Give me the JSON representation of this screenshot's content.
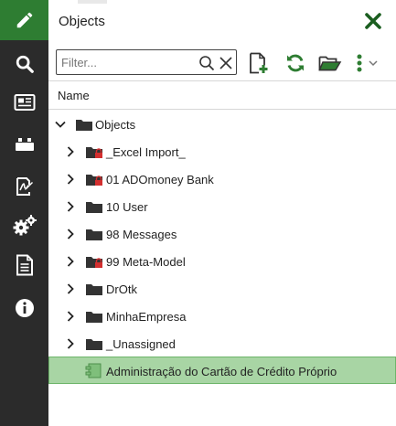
{
  "rail": {
    "items": [
      {
        "icon": "pencil-icon",
        "active": true
      },
      {
        "icon": "search-icon",
        "active": false
      },
      {
        "icon": "newspaper-icon",
        "active": false
      },
      {
        "icon": "blocks-icon",
        "active": false
      },
      {
        "icon": "signature-icon",
        "active": false
      },
      {
        "icon": "gears-icon",
        "active": false
      },
      {
        "icon": "document-icon",
        "active": false
      },
      {
        "icon": "info-icon",
        "active": false
      }
    ]
  },
  "header": {
    "title": "Objects"
  },
  "toolbar": {
    "filter_placeholder": "Filter...",
    "filter_value": ""
  },
  "tree": {
    "column_name": "Name",
    "root": {
      "label": "Objects",
      "expanded": true
    },
    "items": [
      {
        "label": "_Excel Import_",
        "locked": true,
        "type": "folder"
      },
      {
        "label": "01 ADOmoney Bank",
        "locked": true,
        "type": "folder"
      },
      {
        "label": "10 User",
        "locked": false,
        "type": "folder"
      },
      {
        "label": "98 Messages",
        "locked": false,
        "type": "folder"
      },
      {
        "label": "99 Meta-Model",
        "locked": true,
        "type": "folder"
      },
      {
        "label": "DrOtk",
        "locked": false,
        "type": "folder"
      },
      {
        "label": "MinhaEmpresa",
        "locked": false,
        "type": "folder"
      },
      {
        "label": "_Unassigned",
        "locked": false,
        "type": "folder"
      }
    ],
    "selected": {
      "label": "Administração do Cartão de Crédito Próprio",
      "type": "object"
    }
  },
  "colors": {
    "rail_bg": "#2b2b2b",
    "accent": "#2e7d32",
    "selected_bg": "#a8d5a4",
    "lock": "#d32f2f"
  }
}
